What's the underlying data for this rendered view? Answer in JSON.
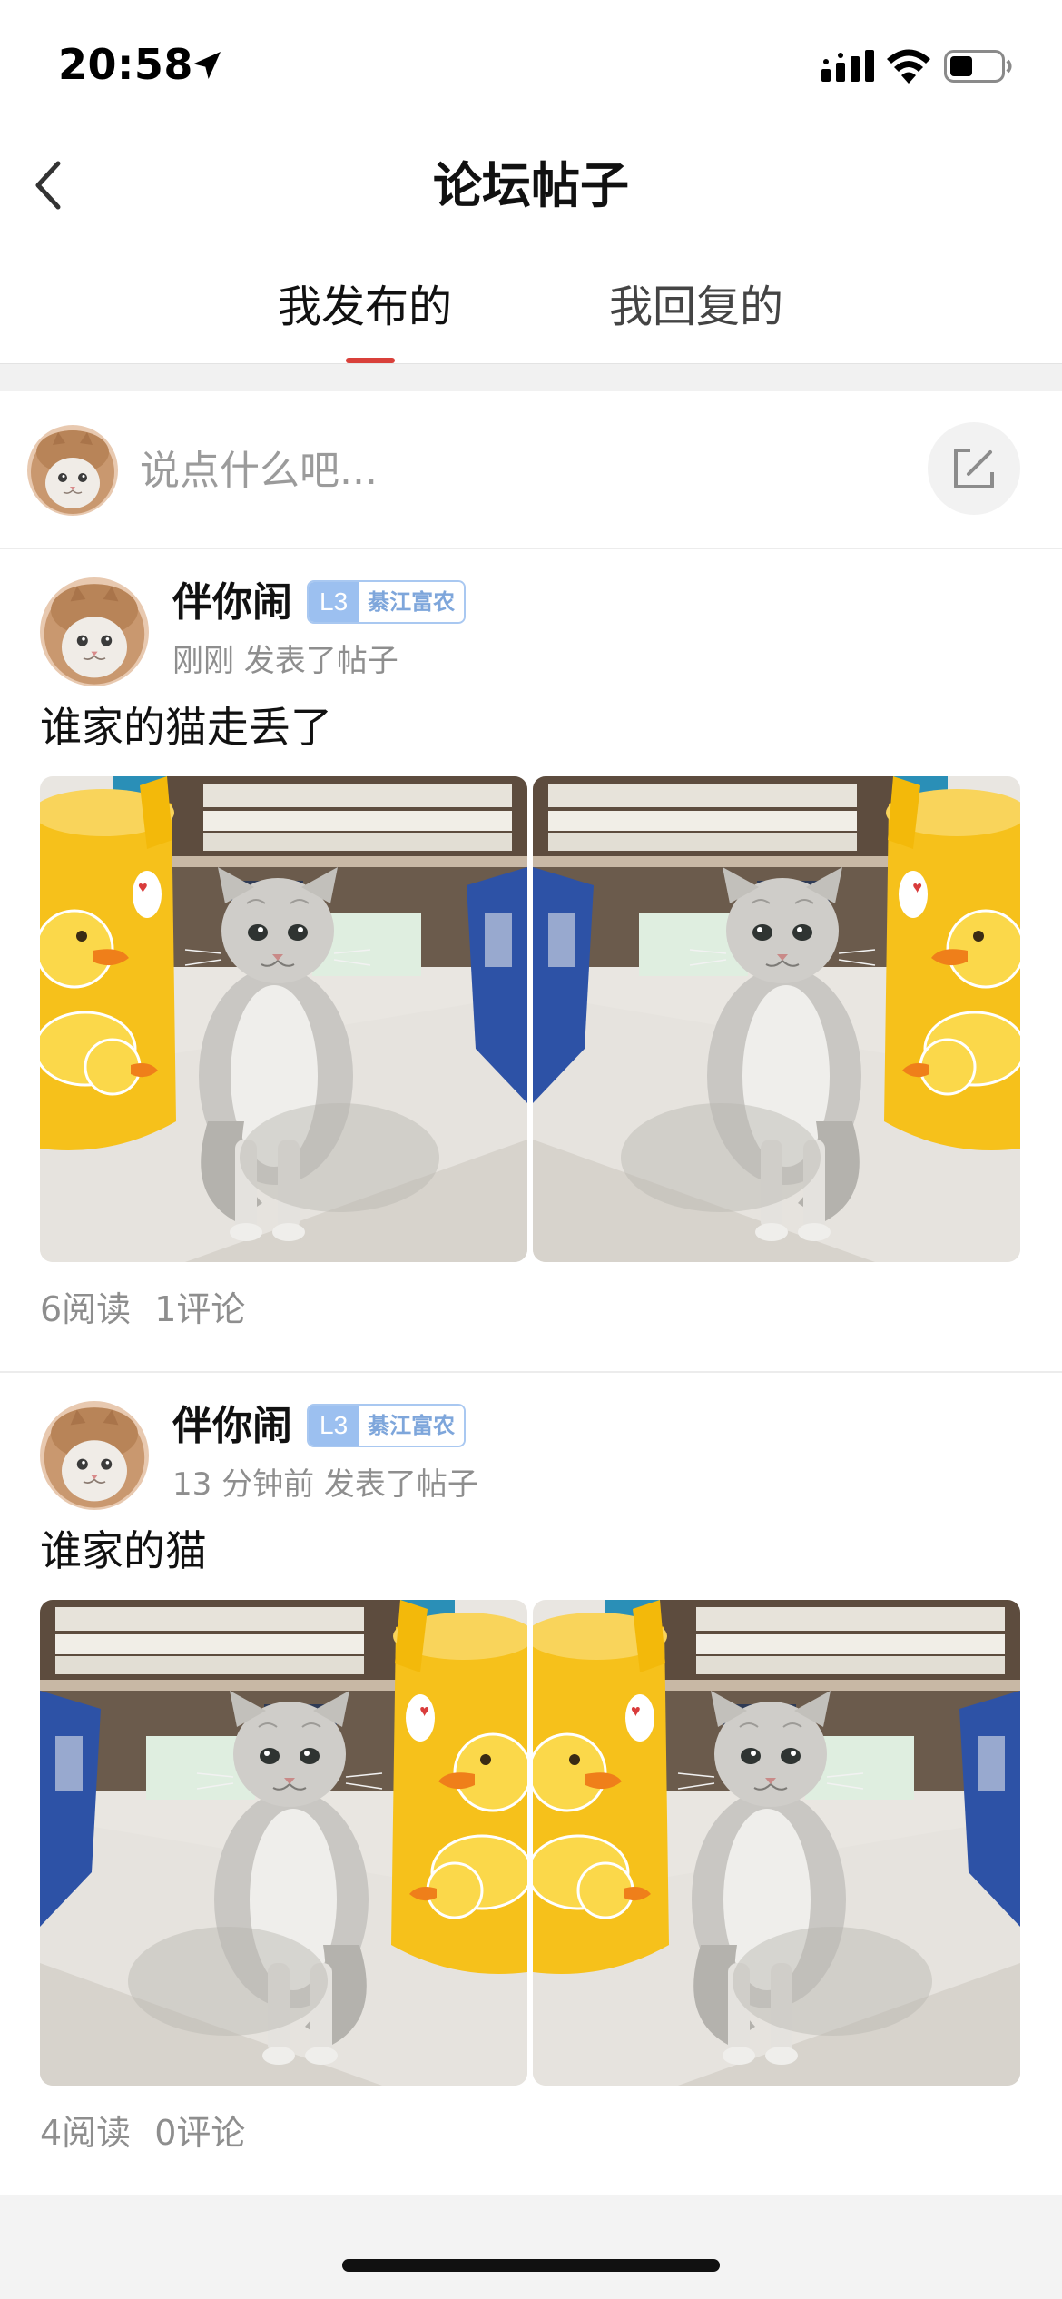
{
  "status_bar": {
    "time": "20:58",
    "location_icon": "location-arrow-icon",
    "signal_icon": "cellular-signal-icon",
    "wifi_icon": "wifi-icon",
    "battery_icon": "battery-icon",
    "battery_level": 0.45
  },
  "nav": {
    "back_icon": "chevron-left-icon",
    "title": "论坛帖子"
  },
  "tabs": [
    {
      "label": "我发布的",
      "active": true
    },
    {
      "label": "我回复的",
      "active": false
    }
  ],
  "colors": {
    "accent": "#d9403a",
    "badge_level_bg": "#9cc0f0",
    "badge_title_text": "#7ea6db",
    "muted_text": "#8e8e8e"
  },
  "composer": {
    "avatar_icon": "cat-avatar",
    "placeholder": "说点什么吧...",
    "edit_icon": "edit-icon"
  },
  "posts": [
    {
      "author": "伴你闹",
      "level": "L3",
      "title_badge": "綦江富农",
      "time": "刚刚 发表了帖子",
      "text": "谁家的猫走丢了",
      "images": [
        "cat-photo",
        "cat-photo"
      ],
      "stats": {
        "reads": "6阅读",
        "comments": "1评论"
      }
    },
    {
      "author": "伴你闹",
      "level": "L3",
      "title_badge": "綦江富农",
      "time": "13 分钟前 发表了帖子",
      "text": "谁家的猫",
      "images": [
        "cat-photo",
        "cat-photo"
      ],
      "stats": {
        "reads": "4阅读",
        "comments": "0评论"
      }
    }
  ]
}
